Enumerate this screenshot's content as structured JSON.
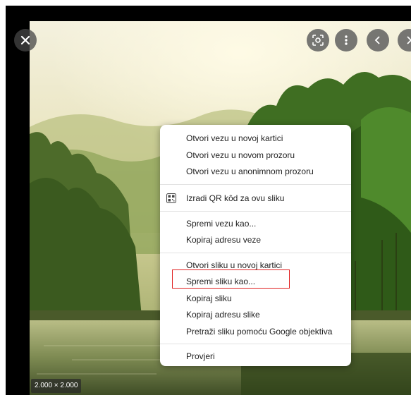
{
  "viewer": {
    "close_icon": "close-icon",
    "toolbar_icons": [
      "lens-icon",
      "more-vert-icon",
      "chevron-left-icon",
      "chevron-right-icon"
    ],
    "dimensions": "2.000 × 2.000"
  },
  "context_menu": {
    "groups": [
      [
        "Otvori vezu u novoj kartici",
        "Otvori vezu u novom prozoru",
        "Otvori vezu u anonimnom prozoru"
      ],
      [
        "Izradi QR kôd za ovu sliku"
      ],
      [
        "Spremi vezu kao...",
        "Kopiraj adresu veze"
      ],
      [
        "Otvori sliku u novoj kartici",
        "Spremi sliku kao...",
        "Kopiraj sliku",
        "Kopiraj adresu slike",
        "Pretraži sliku pomoću Google objektiva"
      ],
      [
        "Provjeri"
      ]
    ],
    "qr_icon": "qr-code-icon",
    "highlighted_item": "Spremi sliku kao...",
    "highlight_color": "#e02020"
  }
}
